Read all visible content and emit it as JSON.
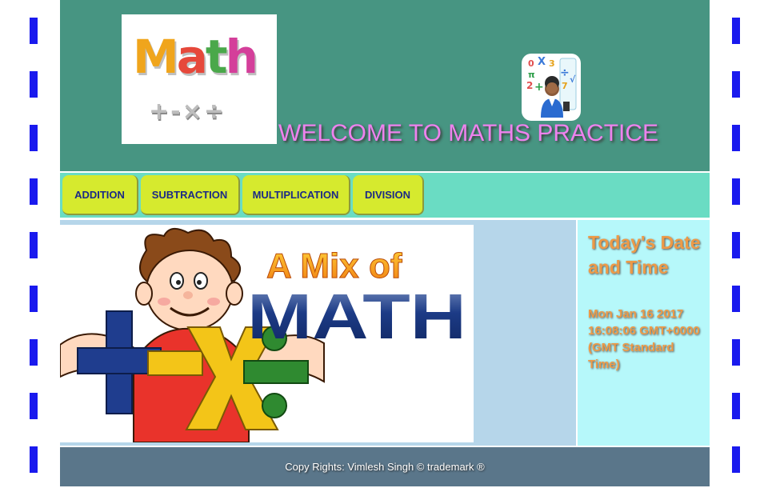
{
  "logo": {
    "letters": [
      "M",
      "a",
      "t",
      "h"
    ],
    "operators": "+-×÷",
    "icon": "math-logo-icon"
  },
  "header": {
    "welcome_text": "WELCOME TO MATHS PRACTICE",
    "mascot_icon": "math-teacher-icon"
  },
  "nav": {
    "items": [
      {
        "label": "ADDITION"
      },
      {
        "label": "SUBTRACTION"
      },
      {
        "label": "MULTIPLICATION"
      },
      {
        "label": "DIVISION"
      }
    ]
  },
  "banner": {
    "line1": "A Mix of",
    "line2": "MATH",
    "icon": "math-boy-illustration"
  },
  "sidebar": {
    "title": "Today's Date and Time",
    "datetime": "Mon Jan 16 2017 16:08:06 GMT+0000 (GMT Standard Time)"
  },
  "footer": {
    "text": "Copy Rights: Vimlesh Singh © trademark ®"
  },
  "colors": {
    "header_bg": "#479582",
    "nav_bg": "#6adcc3",
    "button_bg": "#d6ea2e",
    "button_text": "#1c2a86",
    "welcome_text": "#ee82ee",
    "content_bg": "#b6d6ea",
    "sidebar_bg": "#b6f8fa",
    "sidebar_text": "#ed9a47",
    "footer_bg": "#5a768a",
    "dash_border": "#1a1aee"
  }
}
